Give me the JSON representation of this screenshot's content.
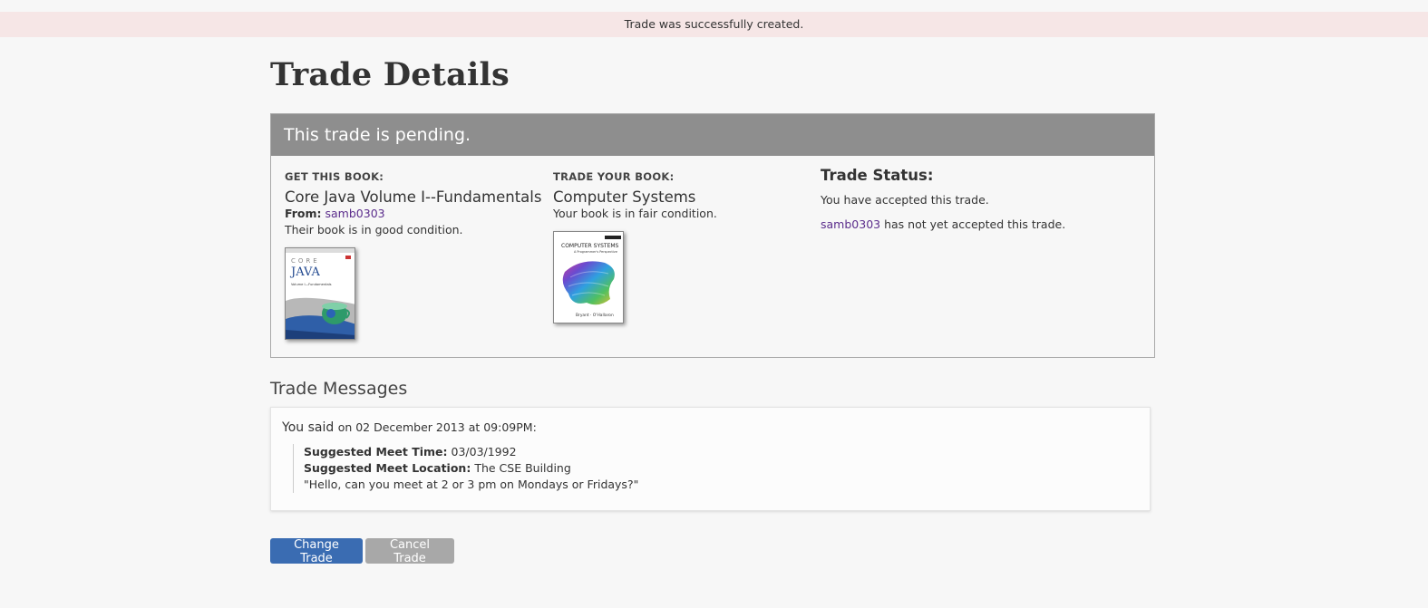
{
  "flash": {
    "message": "Trade was successfully created."
  },
  "page": {
    "title": "Trade Details"
  },
  "trade": {
    "status_banner": "This trade is pending.",
    "get_book": {
      "label": "GET THIS BOOK:",
      "title": "Core Java Volume I--Fundamentals",
      "from_label": "From:",
      "from_user": "samb0303",
      "condition": "Their book is in good condition.",
      "cover": {
        "top_text": "CORE",
        "title_text": "JAVA",
        "subtitle_text": "Volume I—Fundamentals",
        "icon": "coffee-cup-globe-icon"
      }
    },
    "your_book": {
      "label": "TRADE YOUR BOOK:",
      "title": "Computer Systems",
      "condition": "Your book is in fair condition.",
      "cover": {
        "title_text": "COMPUTER SYSTEMS",
        "subtitle_text": "A Programmer's Perspective",
        "authors_text": "Bryant · O'Hallaron",
        "icon": "rainbow-blanket-icon"
      }
    },
    "status": {
      "title": "Trade Status:",
      "you_accepted": "You have accepted this trade.",
      "other_user": "samb0303",
      "other_not_accepted": "has not yet accepted this trade."
    }
  },
  "messages": {
    "title": "Trade Messages",
    "items": [
      {
        "author": "You said",
        "date": "on 02 December 2013 at 09:09PM:",
        "meet_time_label": "Suggested Meet Time:",
        "meet_time": "03/03/1992",
        "meet_location_label": "Suggested Meet Location:",
        "meet_location": "The CSE Building",
        "text": "\"Hello, can you meet at 2 or 3 pm on Mondays or Fridays?\""
      }
    ]
  },
  "actions": {
    "change_label": "Change Trade",
    "cancel_label": "Cancel Trade"
  },
  "colors": {
    "flash_bg": "#f6e6e6",
    "banner_bg": "#8e8e8e",
    "link": "#5b2d8c",
    "primary_button": "#3a6cb2",
    "secondary_button": "#a8a8a8"
  }
}
